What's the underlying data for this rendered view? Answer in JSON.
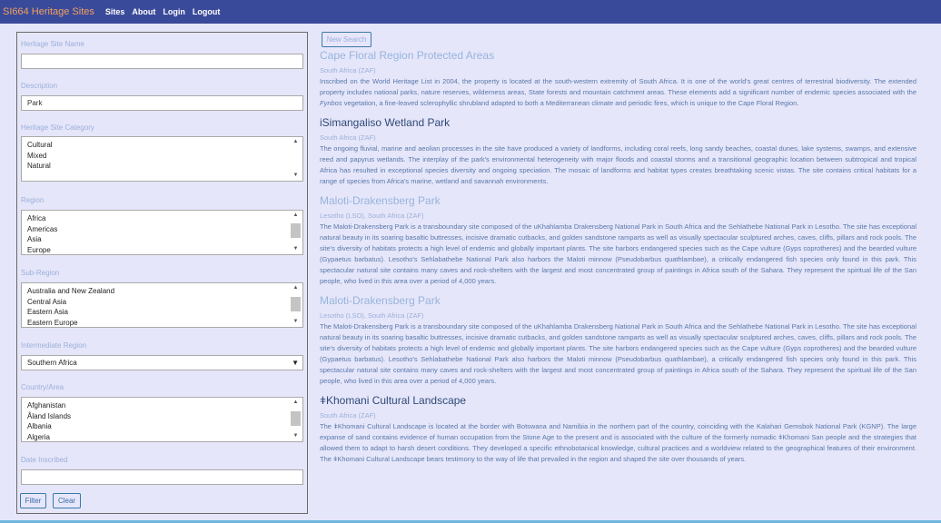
{
  "app": {
    "brand": "SI664 Heritage Sites"
  },
  "nav": {
    "links": [
      "Sites",
      "About",
      "Login",
      "Logout"
    ]
  },
  "filter": {
    "site_name": {
      "label": "Heritage Site Name",
      "value": ""
    },
    "description": {
      "label": "Description",
      "value": "Park"
    },
    "category": {
      "label": "Heritage Site Category",
      "options": [
        "Cultural",
        "Mixed",
        "Natural"
      ]
    },
    "region": {
      "label": "Region",
      "options": [
        "Africa",
        "Americas",
        "Asia",
        "Europe"
      ]
    },
    "sub_region": {
      "label": "Sub-Region",
      "options": [
        "Australia and New Zealand",
        "Central Asia",
        "Eastern Asia",
        "Eastern Europe"
      ]
    },
    "intermediate_region": {
      "label": "Intermediate Region",
      "selected": "Southern Africa"
    },
    "country_area": {
      "label": "Country/Area",
      "options": [
        "Afghanistan",
        "Åland Islands",
        "Albania",
        "Algeria"
      ]
    },
    "date_inscribed": {
      "label": "Date Inscribed",
      "value": ""
    },
    "filter_button": "Filter",
    "clear_button": "Clear"
  },
  "results": {
    "new_search_button": "New Search",
    "items": [
      {
        "title": "Cape Floral Region Protected Areas",
        "country": "South Africa (ZAF)",
        "desc_before": "Inscribed on the World Heritage List in 2004, the property is located at the south-western extremity of South Africa. It is one of the world's great centres of terrestrial biodiversity. The extended property includes national parks, nature reserves, wilderness areas, State forests and mountain catchment areas. These elements add a significant number of endemic species associated with the ",
        "desc_em": "Fynbos",
        "desc_after": " vegetation, a fine-leaved sclerophyllic shrubland adapted to both a Mediterranean climate and periodic fires, which is unique to the Cape Floral Region."
      },
      {
        "title": "iSimangaliso Wetland Park",
        "country": "South Africa (ZAF)",
        "description": "The ongoing fluvial, marine and aeolian processes in the site have produced a variety of landforms, including coral reefs, long sandy beaches, coastal dunes, lake systems, swamps, and extensive reed and papyrus wetlands. The interplay of the park's environmental heterogeneity with major floods and coastal storms and a transitional geographic location between subtropical and tropical Africa has resulted in exceptional species diversity and ongoing speciation. The mosaic of landforms and habitat types creates breathtaking scenic vistas. The site contains critical habitats for a range of species from Africa's marine, wetland and savannah environments."
      },
      {
        "title": "Maloti-Drakensberg Park",
        "country": "Lesotho (LSO), South Africa (ZAF)",
        "description": "The Maloti-Drakensberg Park is a transboundary site composed of the uKhahlamba Drakensberg National Park in South Africa and the Sehlathebe National Park in Lesotho. The site has exceptional natural beauty in its soaring basaltic buttresses, incisive dramatic cutbacks, and golden sandstone ramparts as well as visually spectacular sculptured arches, caves, cliffs, pillars and rock pools. The site's diversity of habitats protects a high level of endemic and globally important plants. The site harbors endangered species such as the Cape vulture (Gyps coprotheres) and the bearded vulture (Gypaetus barbatus). Lesotho's Sehlabathebe National Park also harbors the Maloti minnow (Pseudobarbus quathlambae), a critically endangered fish species only found in this park. This spectacular natural site contains many caves and rock-shelters with the largest and most concentrated group of paintings in Africa south of the Sahara. They represent the spiritual life of the San people, who lived in this area over a period of 4,000 years."
      },
      {
        "title": "Maloti-Drakensberg Park",
        "country": "Lesotho (LSO), South Africa (ZAF)",
        "description": "The Maloti-Drakensberg Park is a transboundary site composed of the uKhahlamba Drakensberg National Park in South Africa and the Sehlathebe National Park in Lesotho. The site has exceptional natural beauty in its soaring basaltic buttresses, incisive dramatic cutbacks, and golden sandstone ramparts as well as visually spectacular sculptured arches, caves, cliffs, pillars and rock pools. The site's diversity of habitats protects a high level of endemic and globally important plants. The site harbors endangered species such as the Cape vulture (Gyps coprotheres) and the bearded vulture (Gypaetus barbatus). Lesotho's Sehlabathebe National Park also harbors the Maloti minnow (Pseudobarbus quathlambae), a critically endangered fish species only found in this park. This spectacular natural site contains many caves and rock-shelters with the largest and most concentrated group of paintings in Africa south of the Sahara. They represent the spiritual life of the San people, who lived in this area over a period of 4,000 years."
      },
      {
        "title": "ǂKhomani Cultural Landscape",
        "country": "South Africa (ZAF)",
        "description": "The ǂKhomani Cultural Landscape is located at the border with Botswana and Namibia in the northern part of the country, coinciding with the Kalahari Gemsbok National Park (KGNP). The large expanse of sand contains evidence of human occupation from the Stone Age to the present and is associated with the culture of the formerly nomadic ǂKhomani San people and the strategies that allowed them to adapt to harsh desert conditions. They developed a specific ethnobotanical knowledge, cultural practices and a worldview related to the geographical features of their environment. The ǂKhomani Cultural Landscape bears testimony to the way of life that prevailed in the region and shaped the site over thousands of years."
      }
    ]
  }
}
